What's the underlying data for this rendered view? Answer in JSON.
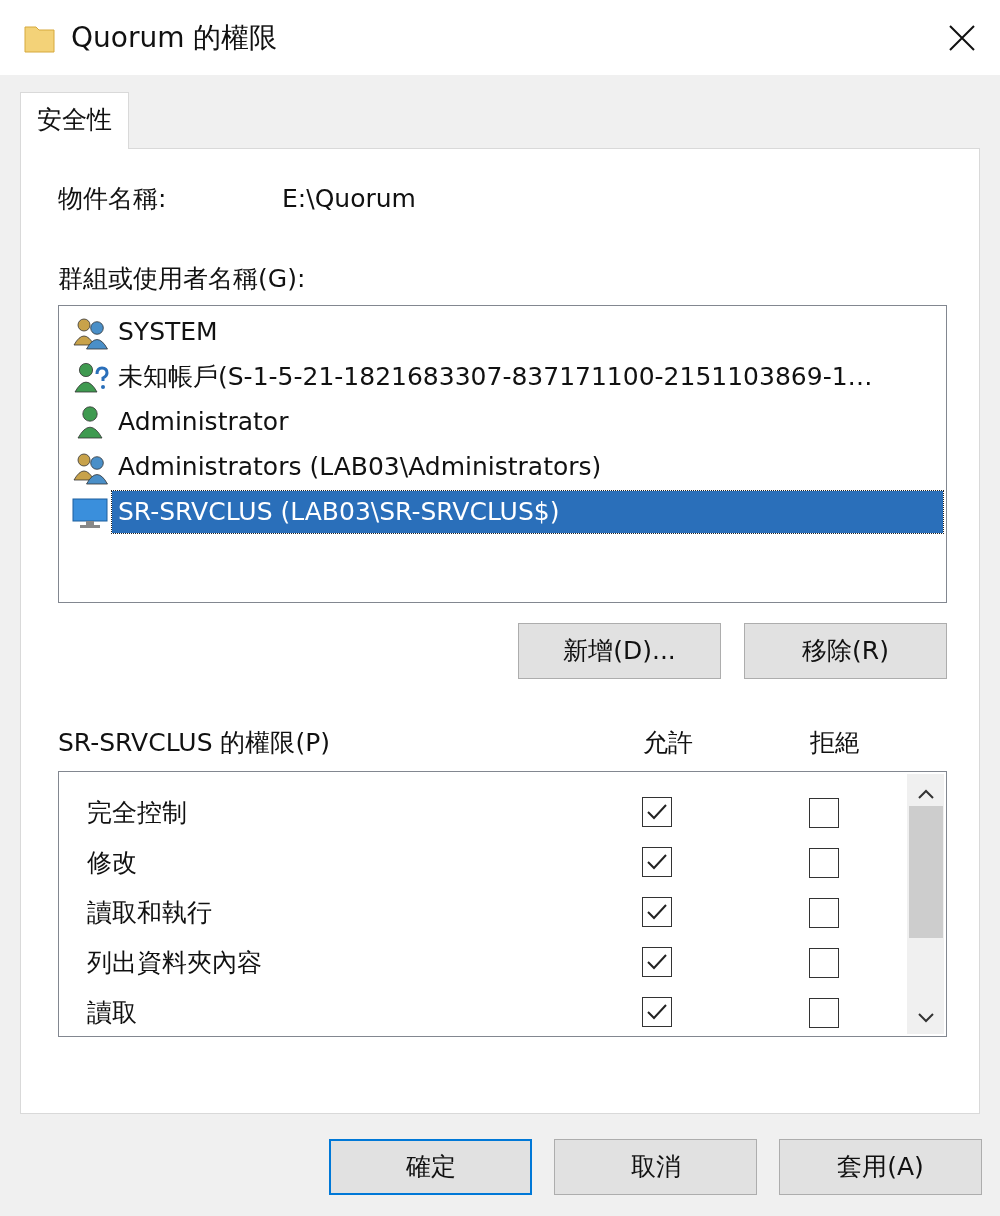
{
  "window": {
    "title": "Quorum 的權限"
  },
  "tabs": [
    {
      "label": "安全性",
      "selected": true
    }
  ],
  "object_name": {
    "label": "物件名稱:",
    "value": "E:\\Quorum"
  },
  "users": {
    "label": "群組或使用者名稱(G):",
    "items": [
      {
        "name": "SYSTEM",
        "kind": "group",
        "selected": false
      },
      {
        "name": "未知帳戶(S-1-5-21-1821683307-837171100-2151103869-1…",
        "kind": "unknown",
        "selected": false
      },
      {
        "name": "Administrator",
        "kind": "user",
        "selected": false
      },
      {
        "name": "Administrators (LAB03\\Administrators)",
        "kind": "group",
        "selected": false
      },
      {
        "name": "SR-SRVCLUS (LAB03\\SR-SRVCLUS$)",
        "kind": "computer",
        "selected": true
      }
    ]
  },
  "user_buttons": [
    "新增(D)...",
    "移除(R)"
  ],
  "permissions": {
    "label": "SR-SRVCLUS 的權限(P)",
    "allow_header": "允許",
    "deny_header": "拒絕",
    "items": [
      {
        "name": "完全控制",
        "allow": true,
        "deny": false
      },
      {
        "name": "修改",
        "allow": true,
        "deny": false
      },
      {
        "name": "讀取和執行",
        "allow": true,
        "deny": false
      },
      {
        "name": "列出資料夾內容",
        "allow": true,
        "deny": false
      },
      {
        "name": "讀取",
        "allow": true,
        "deny": false
      }
    ]
  },
  "buttons": [
    {
      "label": "確定",
      "default": true
    },
    {
      "label": "取消",
      "default": false
    },
    {
      "label": "套用(A)",
      "default": false
    }
  ]
}
